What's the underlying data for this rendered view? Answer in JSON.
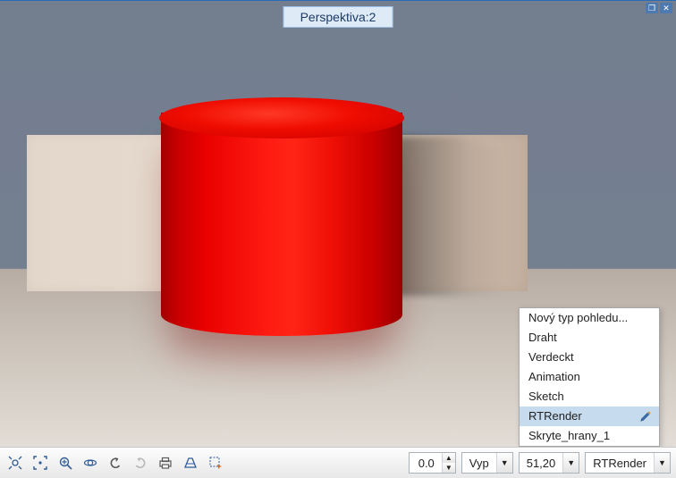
{
  "viewport": {
    "title": "Perspektiva:2"
  },
  "toolbar": {
    "value1": "0.0",
    "dropdown1": "Vyp",
    "value2": "51,20",
    "dropdown2": "RTRender"
  },
  "popup": {
    "items": [
      {
        "label": "Nový typ pohledu...",
        "selected": false
      },
      {
        "label": "Draht",
        "selected": false
      },
      {
        "label": "Verdeckt",
        "selected": false
      },
      {
        "label": "Animation",
        "selected": false
      },
      {
        "label": "Sketch",
        "selected": false
      },
      {
        "label": "RTRender",
        "selected": true,
        "editable": true
      },
      {
        "label": "Skryte_hrany_1",
        "selected": false
      }
    ]
  },
  "icons": {
    "restore": "❐",
    "close": "✕",
    "up": "▲",
    "down": "▼"
  }
}
